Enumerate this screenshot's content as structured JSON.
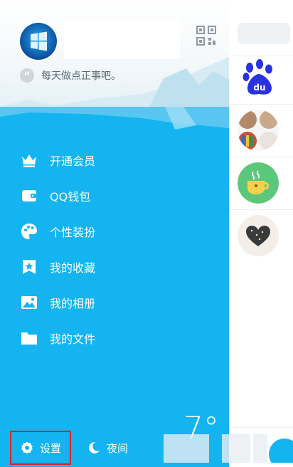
{
  "profile": {
    "signature": "每天做点正事吧。"
  },
  "menu": [
    {
      "label": "开通会员",
      "icon": "crown-icon"
    },
    {
      "label": "QQ钱包",
      "icon": "wallet-icon"
    },
    {
      "label": "个性装扮",
      "icon": "palette-icon"
    },
    {
      "label": "我的收藏",
      "icon": "star-bookmark-icon"
    },
    {
      "label": "我的相册",
      "icon": "photo-album-icon"
    },
    {
      "label": "我的文件",
      "icon": "folder-icon"
    }
  ],
  "weather": {
    "temperature": "7°"
  },
  "bottom": {
    "settings_label": "设置",
    "night_label": "夜间"
  },
  "colors": {
    "drawer_bg": "#13b4f0",
    "highlight": "#d8232a"
  }
}
